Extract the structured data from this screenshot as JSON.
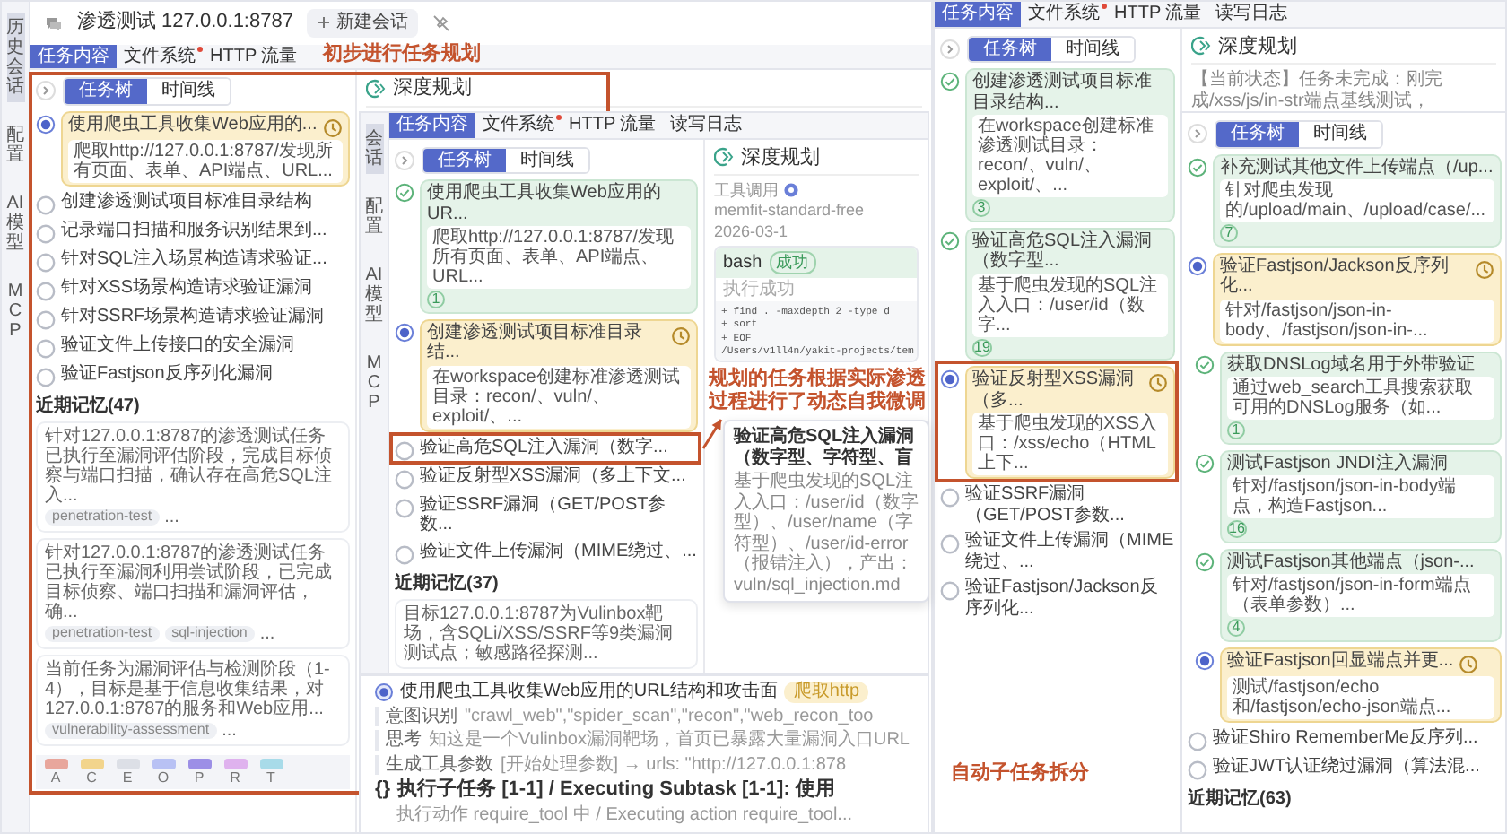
{
  "windows": [
    {
      "rail": [
        {
          "label": "历史会话",
          "selected": true
        },
        {
          "label": "配置",
          "selected": false
        },
        {
          "label": "AI模型",
          "selected": false
        },
        {
          "label": "MCP",
          "selected": false
        }
      ],
      "header": {
        "title": "渗透测试 127.0.0.1:8787",
        "new_button": "新建会话"
      },
      "tabs": [
        {
          "label": "任务内容",
          "selected": true,
          "dot": false
        },
        {
          "label": "文件系统",
          "selected": false,
          "dot": true
        },
        {
          "label": "HTTP 流量",
          "selected": false,
          "dot": false
        }
      ],
      "view_switch": [
        {
          "label": "任务树",
          "selected": true
        },
        {
          "label": "时间线",
          "selected": false
        }
      ],
      "tasks": [
        {
          "title": "使用爬虫工具收集Web应用的...",
          "kind": "running",
          "description": "爬取http://127.0.0.1:8787/发现所有页面、表单、API端点、URL..."
        },
        {
          "title": "创建渗透测试项目标准目录结构",
          "kind": "pending"
        },
        {
          "title": "记录端口扫描和服务识别结果到...",
          "kind": "pending"
        },
        {
          "title": "针对SQL注入场景构造请求验证...",
          "kind": "pending"
        },
        {
          "title": "针对XSS场景构造请求验证漏洞",
          "kind": "pending"
        },
        {
          "title": "针对SSRF场景构造请求验证漏洞",
          "kind": "pending"
        },
        {
          "title": "验证文件上传接口的安全漏洞",
          "kind": "pending"
        },
        {
          "title": "验证Fastjson反序列化漏洞",
          "kind": "pending"
        }
      ],
      "memory": {
        "title": "近期记忆(47)",
        "cards": [
          {
            "text": "针对127.0.0.1:8787的渗透测试任务已执行至漏洞评估阶段，完成目标侦察与端口扫描，确认存在高危SQL注入...",
            "tags": [
              "penetration-test"
            ],
            "more": "..."
          },
          {
            "text": "针对127.0.0.1:8787的渗透测试任务已执行至漏洞利用尝试阶段，已完成目标侦察、端口扫描和漏洞评估，确...",
            "tags": [
              "penetration-test",
              "sql-injection"
            ],
            "more": "..."
          },
          {
            "text": "当前任务为漏洞评估与检测阶段（1-4），目标是基于信息收集结果，对127.0.0.1:8787的服务和Web应用...",
            "tags": [
              "vulnerability-assessment"
            ],
            "more": "..."
          }
        ]
      },
      "legend": [
        {
          "letter": "A",
          "color": "#e8a69c"
        },
        {
          "letter": "C",
          "color": "#f2d48c"
        },
        {
          "letter": "E",
          "color": "#dcdfe6"
        },
        {
          "letter": "O",
          "color": "#b8c1f4"
        },
        {
          "letter": "P",
          "color": "#9c8fe6"
        },
        {
          "letter": "R",
          "color": "#dfb2ee"
        },
        {
          "letter": "T",
          "color": "#a8dbe9"
        }
      ],
      "planning": {
        "title": "深度规划"
      }
    },
    {
      "rail": [
        {
          "label": "会话",
          "selected": true
        },
        {
          "label": "配置",
          "selected": false
        },
        {
          "label": "AI模型",
          "selected": false
        },
        {
          "label": "MCP",
          "selected": false
        }
      ],
      "tabs": [
        {
          "label": "任务内容",
          "selected": true,
          "dot": false
        },
        {
          "label": "文件系统",
          "selected": false,
          "dot": true
        },
        {
          "label": "HTTP 流量",
          "selected": false,
          "dot": false
        },
        {
          "label": "读写日志",
          "selected": false,
          "dot": false
        }
      ],
      "view_switch": [
        {
          "label": "任务树",
          "selected": true
        },
        {
          "label": "时间线",
          "selected": false
        }
      ],
      "tasks": [
        {
          "title": "使用爬虫工具收集Web应用的UR...",
          "kind": "done",
          "description": "爬取http://127.0.0.1:8787/发现所有页面、表单、API端点、URL...",
          "count": "1"
        },
        {
          "title": "创建渗透测试项目标准目录结...",
          "kind": "running",
          "description": "在workspace创建标准渗透测试目录：recon/、vuln/、exploit/、..."
        },
        {
          "title": "验证高危SQL注入漏洞（数字...",
          "kind": "pending"
        },
        {
          "title": "验证反射型XSS漏洞（多上下文...",
          "kind": "pending"
        },
        {
          "title": "验证SSRF漏洞（GET/POST参数...",
          "kind": "pending"
        },
        {
          "title": "验证文件上传漏洞（MIME绕过、...",
          "kind": "pending"
        }
      ],
      "memory": {
        "title": "近期记忆(37)",
        "cards": [
          {
            "text": "目标127.0.0.1:8787为Vulinbox靶场，含SQLi/XSS/SSRF等9类漏洞测试点；敏感路径探测..."
          }
        ]
      },
      "planning": {
        "title": "深度规划",
        "blocks": [
          {
            "kind": "tool_call",
            "label": "工具调用",
            "model": "memfit-standard-free",
            "time": "2026-03-1"
          },
          {
            "kind": "result",
            "name": "bash",
            "badge": "成功",
            "status": "执行成功",
            "code": [
              "+ find . -maxdepth 2 -type d",
              "+ sort",
              "+ EOF",
              "/Users/v1ll4n/yakit-projects/tem"
            ]
          }
        ]
      },
      "tooltip": {
        "title": "验证高危SQL注入漏洞（数字型、字符型、盲",
        "text": "基于爬虫发现的SQL注入入口：/user/id（数字型）、/user/name（字符型）、/user/id-error（报错注入），产出：vuln/sql_injection.md"
      }
    },
    {
      "timeline": [
        {
          "kind": "step",
          "title": "使用爬虫工具收集Web应用的URL结构和攻击面",
          "badge": "爬取http"
        },
        {
          "kind": "field",
          "label": "意图识别",
          "value": "\"crawl_web\",\"spider_scan\",\"recon\",\"web_recon_too"
        },
        {
          "kind": "field",
          "label": "思考",
          "value": "知这是一个Vulinbox漏洞靶场，首页已暴露大量漏洞入口URL"
        },
        {
          "kind": "field",
          "label": "生成工具参数",
          "value": "[开始处理参数] → urls: \"http://127.0.0.1:878"
        },
        {
          "kind": "subtask",
          "glyph": "{}",
          "title": "执行子任务 [1-1] / Executing Subtask [1-1]: 使用",
          "detail": "执行动作 require_tool 中 / Executing action require_tool..."
        }
      ]
    },
    {
      "tabs": [
        {
          "label": "任务内容",
          "selected": true,
          "dot": false
        },
        {
          "label": "文件系统",
          "selected": false,
          "dot": true
        },
        {
          "label": "HTTP 流量",
          "selected": false,
          "dot": false
        },
        {
          "label": "读写日志",
          "selected": false,
          "dot": false
        }
      ],
      "view_switch": [
        {
          "label": "任务树",
          "selected": true
        },
        {
          "label": "时间线",
          "selected": false
        }
      ],
      "tasks": [
        {
          "title": "创建渗透测试项目标准目录结构...",
          "kind": "done",
          "description": "在workspace创建标准渗透测试目录：recon/、vuln/、exploit/、...",
          "count": "3"
        },
        {
          "title": "验证高危SQL注入漏洞（数字型...",
          "kind": "done",
          "description": "基于爬虫发现的SQL注入入口：/user/id（数字...",
          "count": "19"
        },
        {
          "title": "验证反射型XSS漏洞（多...",
          "kind": "running",
          "description": "基于爬虫发现的XSS入口：/xss/echo（HTML上下..."
        },
        {
          "title": "验证SSRF漏洞（GET/POST参数...",
          "kind": "pending"
        },
        {
          "title": "验证文件上传漏洞（MIME绕过、...",
          "kind": "pending"
        },
        {
          "title": "验证Fastjson/Jackson反序列化...",
          "kind": "pending"
        }
      ],
      "planning": {
        "title": "深度规划",
        "blocks": [
          {
            "kind": "text",
            "text": "【当前状态】任务未完成：刚完成/xss/js/in-str端点基线测试，"
          }
        ]
      }
    },
    {
      "view_switch": [
        {
          "label": "任务树",
          "selected": true
        },
        {
          "label": "时间线",
          "selected": false
        }
      ],
      "tasks": [
        {
          "title": "补充测试其他文件上传端点（/up...",
          "kind": "done",
          "description": "针对爬虫发现的/upload/main、/upload/case/...",
          "count": "7"
        },
        {
          "title": "验证Fastjson/Jackson反序列化...",
          "kind": "running",
          "description": "针对/fastjson/json-in-body、/fastjson/json-in-...",
          "children": [
            {
              "title": "获取DNSLog域名用于外带验证",
              "kind": "done",
              "description": "通过web_search工具搜索获取可用的DNSLog服务（如...",
              "count": "1"
            },
            {
              "title": "测试Fastjson JNDI注入漏洞",
              "kind": "done",
              "description": "针对/fastjson/json-in-body端点，构造Fastjson...",
              "count": "16"
            },
            {
              "title": "测试Fastjson其他端点（json-...",
              "kind": "done",
              "description": "针对/fastjson/json-in-form端点（表单参数）...",
              "count": "4"
            },
            {
              "title": "验证Fastjson回显端点并更...",
              "kind": "running",
              "description": "测试/fastjson/echo和/fastjson/echo-json端点..."
            }
          ]
        },
        {
          "title": "验证Shiro RememberMe反序列...",
          "kind": "pending"
        },
        {
          "title": "验证JWT认证绕过漏洞（算法混...",
          "kind": "pending"
        }
      ],
      "memory": {
        "title": "近期记忆(63)"
      }
    }
  ],
  "annotations": [
    {
      "kind": "label",
      "text": "初步进行任务规划"
    },
    {
      "kind": "frame"
    },
    {
      "kind": "frame"
    },
    {
      "kind": "arrow"
    },
    {
      "kind": "label",
      "text": "规划的任务根据实际渗透过程进行了动态自我微调"
    },
    {
      "kind": "frame"
    },
    {
      "kind": "label",
      "text": "自动子任务拆分"
    }
  ]
}
